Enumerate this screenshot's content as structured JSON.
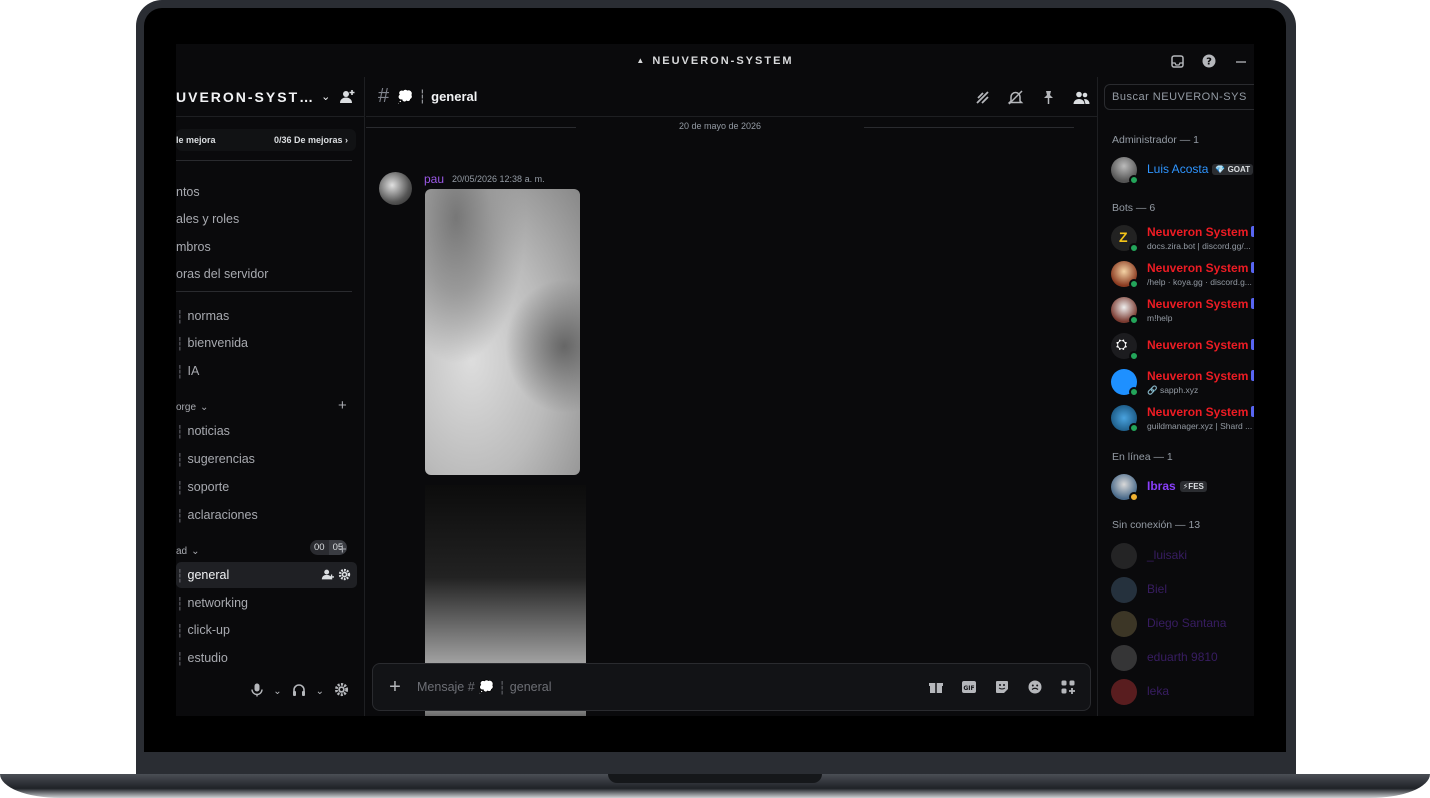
{
  "window": {
    "title": "NEUVERON-SYSTEM"
  },
  "server": {
    "name": "UVERON-SYST…",
    "boost_left": "le mejora",
    "boost_right": "0/36 De mejoras",
    "menu": [
      "ntos",
      "ales y roles",
      "mbros",
      "oras del servidor"
    ]
  },
  "channels_top": [
    "normas",
    "bienvenida",
    "IA"
  ],
  "category_1": {
    "label": "orge"
  },
  "channels_cat1": [
    "noticias",
    "sugerencias",
    "soporte",
    "aclaraciones"
  ],
  "badges": [
    "00",
    "05"
  ],
  "category_2": {
    "label": "ad"
  },
  "channels_cat2": [
    "general",
    "networking",
    "click-up",
    "estudio"
  ],
  "channel": {
    "name": "general",
    "separator": "┆"
  },
  "date_divider": "20 de mayo de 2026",
  "message": {
    "author": "pau",
    "timestamp": "20/05/2026 12:38 a. m."
  },
  "composer": {
    "placeholder_prefix": "Mensaje #",
    "placeholder_channel": "general"
  },
  "search": {
    "placeholder": "Buscar NEUVERON-SYS"
  },
  "member_sections": {
    "admin": "Administrador — 1",
    "bots": "Bots — 6",
    "online": "En línea — 1",
    "offline": "Sin conexión — 13"
  },
  "admins": [
    {
      "name": "Luis Acosta",
      "tag": "GOAT",
      "color": "#2f95ff"
    }
  ],
  "bots": [
    {
      "name": "Neuveron System",
      "sub": "docs.zira.bot | discord.gg/..."
    },
    {
      "name": "Neuveron System",
      "sub": "/help · koya.gg · discord.g..."
    },
    {
      "name": "Neuveron System",
      "sub": "m!help"
    },
    {
      "name": "Neuveron System",
      "sub": ""
    },
    {
      "name": "Neuveron System",
      "sub": "🔗 sapph.xyz"
    },
    {
      "name": "Neuveron System",
      "sub": "guildmanager.xyz | Shard ..."
    }
  ],
  "online": [
    {
      "name": "Ibras",
      "tag": "⚡FES",
      "color": "#8a3ffc"
    }
  ],
  "offline_members": [
    "_luisaki",
    "Biel",
    "Diego Santana",
    "eduarth 9810",
    "leka"
  ],
  "colors": {
    "bot_name": "#ed1c24",
    "accent": "#5865f2",
    "online": "#23a55a"
  }
}
